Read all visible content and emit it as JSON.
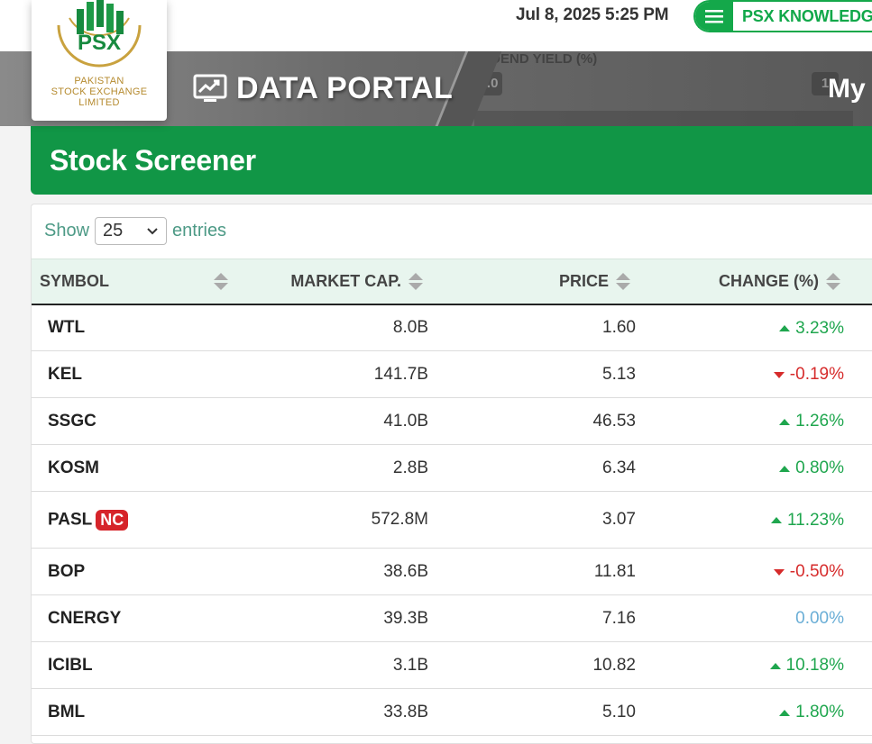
{
  "topbar": {
    "datetime": "Jul 8, 2025 5:25 PM",
    "knowledge_label": "PSX KNOWLEDGE"
  },
  "logo": {
    "mark": "PSX",
    "line1": "PAKISTAN",
    "line2": "STOCK EXCHANGE",
    "line3": "LIMITED"
  },
  "hero": {
    "title": "DATA PORTAL",
    "my_link": "My I",
    "ghost_label": "VIDEND YIELD (%)",
    "ghost_chip_1": "0.0",
    "ghost_chip_2": "1"
  },
  "banner": {
    "title": "Stock Screener"
  },
  "entries": {
    "show_label": "Show",
    "selected": "25",
    "entries_label": "entries"
  },
  "table": {
    "headers": {
      "symbol": "SYMBOL",
      "market_cap": "MARKET CAP.",
      "price": "PRICE",
      "change": "CHANGE (%)"
    },
    "rows": [
      {
        "symbol": "WTL",
        "market_cap": "8.0B",
        "price": "1.60",
        "change": "3.23%",
        "direction": "up"
      },
      {
        "symbol": "KEL",
        "market_cap": "141.7B",
        "price": "5.13",
        "change": "-0.19%",
        "direction": "down"
      },
      {
        "symbol": "SSGC",
        "market_cap": "41.0B",
        "price": "46.53",
        "change": "1.26%",
        "direction": "up"
      },
      {
        "symbol": "KOSM",
        "market_cap": "2.8B",
        "price": "6.34",
        "change": "0.80%",
        "direction": "up"
      },
      {
        "symbol": "PASL",
        "badge": "NC",
        "market_cap": "572.8M",
        "price": "3.07",
        "change": "11.23%",
        "direction": "up"
      },
      {
        "symbol": "BOP",
        "market_cap": "38.6B",
        "price": "11.81",
        "change": "-0.50%",
        "direction": "down"
      },
      {
        "symbol": "CNERGY",
        "market_cap": "39.3B",
        "price": "7.16",
        "change": "0.00%",
        "direction": "none"
      },
      {
        "symbol": "ICIBL",
        "market_cap": "3.1B",
        "price": "10.82",
        "change": "10.18%",
        "direction": "up"
      },
      {
        "symbol": "BML",
        "market_cap": "33.8B",
        "price": "5.10",
        "change": "1.80%",
        "direction": "up"
      }
    ]
  },
  "colors": {
    "brand_green": "#119646",
    "positive": "#1fa64e",
    "negative": "#d62b2b",
    "neutral": "#6aaed6",
    "badge": "#d6242a"
  }
}
